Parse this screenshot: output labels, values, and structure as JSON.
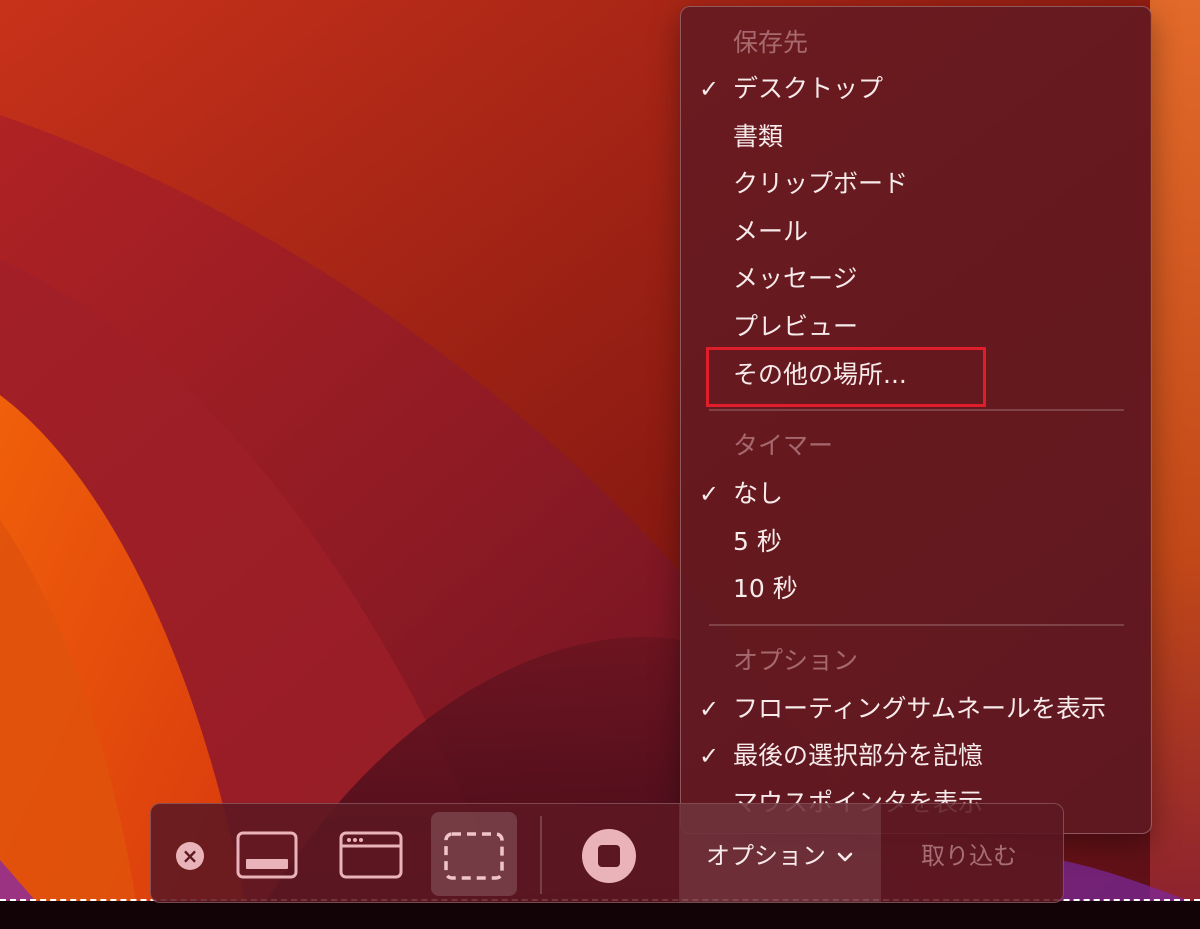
{
  "colors": {
    "menu_background": "#601a22",
    "menu_text": "#f6eaea",
    "menu_header_text": "#c9a0a6",
    "highlight_box": "#e01d2b",
    "toolbar_background": "#5c1822",
    "icon_color": "#e9b3b9"
  },
  "menu": {
    "sections": [
      {
        "header": "保存先",
        "items": [
          {
            "label": "デスクトップ",
            "checked": true
          },
          {
            "label": "書類",
            "checked": false
          },
          {
            "label": "クリップボード",
            "checked": false
          },
          {
            "label": "メール",
            "checked": false
          },
          {
            "label": "メッセージ",
            "checked": false
          },
          {
            "label": "プレビュー",
            "checked": false
          },
          {
            "label": "その他の場所...",
            "checked": false,
            "highlighted": true
          }
        ]
      },
      {
        "header": "タイマー",
        "items": [
          {
            "label": "なし",
            "checked": true
          },
          {
            "label": "5 秒",
            "checked": false
          },
          {
            "label": "10 秒",
            "checked": false
          }
        ]
      },
      {
        "header": "オプション",
        "items": [
          {
            "label": "フローティングサムネールを表示",
            "checked": true
          },
          {
            "label": "最後の選択部分を記憶",
            "checked": true
          },
          {
            "label": "マウスポインタを表示",
            "checked": false
          }
        ]
      }
    ],
    "checkmark": "✓"
  },
  "toolbar": {
    "close_icon": "×",
    "buttons": [
      {
        "name": "capture-entire-screen",
        "icon": "screen-icon",
        "selected": false
      },
      {
        "name": "capture-window",
        "icon": "window-icon",
        "selected": false
      },
      {
        "name": "capture-selection",
        "icon": "selection-icon",
        "selected": true
      },
      {
        "name": "record-screen",
        "icon": "record-stop-icon",
        "selected": false
      }
    ],
    "options_label": "オプション",
    "options_chevron": "chevron-down-icon",
    "capture_label": "取り込む"
  }
}
